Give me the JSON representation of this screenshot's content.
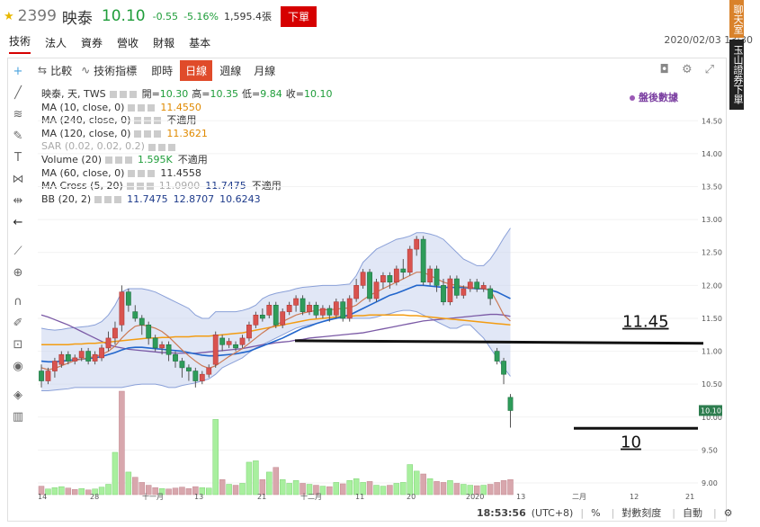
{
  "header": {
    "code": "2399",
    "name": "映泰",
    "price": "10.10",
    "change": "-0.55",
    "change_pct": "-5.16%",
    "volume": "1,595.4張",
    "order_button": "下單"
  },
  "side_buttons": {
    "chat": "聊天室",
    "order": "玉山證券下單"
  },
  "tabs": [
    "技術",
    "法人",
    "資券",
    "營收",
    "財報",
    "基本"
  ],
  "active_tab": "技術",
  "datetime": "2020/02/03 13:30",
  "toolbar": {
    "compare": "比較",
    "indicators": "技術指標",
    "realtime": "即時",
    "periods": [
      "日線",
      "週線",
      "月線"
    ],
    "active_period": "日線"
  },
  "legend": {
    "title": "映泰, 天, TWS",
    "ohlc": {
      "open_label": "開=",
      "open": "10.30",
      "high_label": "高=",
      "high": "10.35",
      "low_label": "低=",
      "low": "9.84",
      "close_label": "收=",
      "close": "10.10"
    },
    "rows": [
      {
        "label": "MA (10, close, 0)",
        "value": "11.4550",
        "extra": ""
      },
      {
        "label": "MA (240, close, 0)",
        "value": "",
        "extra": "不適用"
      },
      {
        "label": "MA (120, close, 0)",
        "value": "11.3621",
        "extra": ""
      },
      {
        "label": "SAR (0.02, 0.02, 0.2)",
        "value": "",
        "extra": ""
      },
      {
        "label": "Volume (20)",
        "value": "1.595K",
        "extra": "不適用"
      },
      {
        "label": "MA (60, close, 0)",
        "value": "11.4558",
        "extra": ""
      },
      {
        "label": "MA Cross (5, 20)",
        "value": "11.0900",
        "value2": "11.7475",
        "extra": "不適用"
      },
      {
        "label": "BB (20, 2)",
        "value": "11.7475",
        "value2": "12.8707",
        "value3": "10.6243"
      }
    ]
  },
  "after_data_label": "盤後數據",
  "annotations": {
    "line1": "11.45",
    "line2": "10"
  },
  "status": {
    "time": "18:53:56",
    "tz": "(UTC+8)",
    "pct": "%",
    "log": "對數刻度",
    "auto": "自動"
  },
  "colors": {
    "up": "#d9534f",
    "down": "#2e9c5a",
    "ma10": "#c0392b",
    "ma_orange": "#f39c12",
    "ma_blue": "#2266cc",
    "ma_purple": "#7b5aa6",
    "bb_fill": "#c9d3ef"
  },
  "chart_data": {
    "type": "candlestick",
    "y_ticks": [
      "14.50",
      "14.00",
      "13.50",
      "13.00",
      "12.50",
      "12.00",
      "11.50",
      "11.00",
      "10.50",
      "10.00",
      "9.50",
      "9.00"
    ],
    "ylim": [
      8.85,
      14.75
    ],
    "x_ticks": [
      "14",
      "28",
      "十一月",
      "13",
      "21",
      "十二月",
      "11",
      "20",
      "2020",
      "13",
      "二月",
      "12",
      "21"
    ],
    "last_price_label": "10.10",
    "candles": [
      [
        10.7,
        10.55,
        10.8,
        10.45
      ],
      [
        10.55,
        10.7,
        10.75,
        10.5
      ],
      [
        10.7,
        10.85,
        10.9,
        10.6
      ],
      [
        10.8,
        10.95,
        11.0,
        10.75
      ],
      [
        10.95,
        10.85,
        11.0,
        10.8
      ],
      [
        10.85,
        10.9,
        10.95,
        10.8
      ],
      [
        10.9,
        11.0,
        11.05,
        10.85
      ],
      [
        11.0,
        10.85,
        11.05,
        10.8
      ],
      [
        10.85,
        10.95,
        11.0,
        10.8
      ],
      [
        10.9,
        11.05,
        11.1,
        10.85
      ],
      [
        11.05,
        11.2,
        11.3,
        11.0
      ],
      [
        11.2,
        11.35,
        11.45,
        11.1
      ],
      [
        11.4,
        11.9,
        12.0,
        11.3
      ],
      [
        11.9,
        11.7,
        11.95,
        11.6
      ],
      [
        11.6,
        11.5,
        11.7,
        11.45
      ],
      [
        11.5,
        11.4,
        11.55,
        11.25
      ],
      [
        11.4,
        11.2,
        11.45,
        11.1
      ],
      [
        11.2,
        11.05,
        11.25,
        11.0
      ],
      [
        11.05,
        11.1,
        11.15,
        10.95
      ],
      [
        11.1,
        10.95,
        11.15,
        10.85
      ],
      [
        10.95,
        10.85,
        11.0,
        10.75
      ],
      [
        10.85,
        10.75,
        10.9,
        10.6
      ],
      [
        10.75,
        10.7,
        10.8,
        10.55
      ],
      [
        10.7,
        10.55,
        10.75,
        10.45
      ],
      [
        10.55,
        10.65,
        10.7,
        10.5
      ],
      [
        10.65,
        10.75,
        10.8,
        10.6
      ],
      [
        10.8,
        11.25,
        11.3,
        10.75
      ],
      [
        11.2,
        11.1,
        11.25,
        11.0
      ],
      [
        11.1,
        11.15,
        11.2,
        11.05
      ],
      [
        11.1,
        11.05,
        11.15,
        11.0
      ],
      [
        11.1,
        11.2,
        11.25,
        11.05
      ],
      [
        11.2,
        11.4,
        11.45,
        11.15
      ],
      [
        11.4,
        11.55,
        11.6,
        11.35
      ],
      [
        11.55,
        11.5,
        11.65,
        11.45
      ],
      [
        11.55,
        11.7,
        11.75,
        11.5
      ],
      [
        11.7,
        11.4,
        11.75,
        11.35
      ],
      [
        11.4,
        11.6,
        11.65,
        11.35
      ],
      [
        11.6,
        11.7,
        11.75,
        11.55
      ],
      [
        11.7,
        11.8,
        11.85,
        11.6
      ],
      [
        11.8,
        11.6,
        11.85,
        11.55
      ],
      [
        11.6,
        11.7,
        11.75,
        11.55
      ],
      [
        11.7,
        11.55,
        11.75,
        11.5
      ],
      [
        11.55,
        11.65,
        11.7,
        11.5
      ],
      [
        11.65,
        11.55,
        11.7,
        11.45
      ],
      [
        11.55,
        11.75,
        11.8,
        11.5
      ],
      [
        11.75,
        11.5,
        11.8,
        11.45
      ],
      [
        11.5,
        11.8,
        11.85,
        11.45
      ],
      [
        11.8,
        12.0,
        12.1,
        11.75
      ],
      [
        12.0,
        12.2,
        12.25,
        11.95
      ],
      [
        12.2,
        11.8,
        12.25,
        11.75
      ],
      [
        11.8,
        12.05,
        12.1,
        11.75
      ],
      [
        12.05,
        12.15,
        12.2,
        11.95
      ],
      [
        12.15,
        12.05,
        12.2,
        11.95
      ],
      [
        12.05,
        12.25,
        12.3,
        12.0
      ],
      [
        12.25,
        12.2,
        12.4,
        12.1
      ],
      [
        12.2,
        12.55,
        12.6,
        12.15
      ],
      [
        12.55,
        12.7,
        12.75,
        12.45
      ],
      [
        12.7,
        12.05,
        12.75,
        12.0
      ],
      [
        12.05,
        12.25,
        12.3,
        12.0
      ],
      [
        12.25,
        12.0,
        12.3,
        11.9
      ],
      [
        12.0,
        11.75,
        12.1,
        11.7
      ],
      [
        11.75,
        12.1,
        12.15,
        11.7
      ],
      [
        12.1,
        11.85,
        12.15,
        11.8
      ],
      [
        11.85,
        11.95,
        12.0,
        11.8
      ],
      [
        11.95,
        12.05,
        12.1,
        11.9
      ],
      [
        12.05,
        11.95,
        12.1,
        11.9
      ],
      [
        11.95,
        12.0,
        12.05,
        11.9
      ],
      [
        11.95,
        11.8,
        12.0,
        11.7
      ],
      [
        11.0,
        10.85,
        11.05,
        10.8
      ],
      [
        10.85,
        10.65,
        10.9,
        10.5
      ],
      [
        10.3,
        10.1,
        10.35,
        9.84
      ]
    ],
    "volumes": [
      [
        180,
        "down"
      ],
      [
        120,
        "up"
      ],
      [
        150,
        "up"
      ],
      [
        170,
        "up"
      ],
      [
        140,
        "down"
      ],
      [
        110,
        "down"
      ],
      [
        130,
        "up"
      ],
      [
        100,
        "down"
      ],
      [
        120,
        "up"
      ],
      [
        160,
        "up"
      ],
      [
        220,
        "up"
      ],
      [
        900,
        "up"
      ],
      [
        2200,
        "down"
      ],
      [
        480,
        "up"
      ],
      [
        370,
        "down"
      ],
      [
        260,
        "down"
      ],
      [
        200,
        "down"
      ],
      [
        150,
        "down"
      ],
      [
        130,
        "up"
      ],
      [
        120,
        "down"
      ],
      [
        140,
        "down"
      ],
      [
        160,
        "down"
      ],
      [
        130,
        "down"
      ],
      [
        170,
        "down"
      ],
      [
        150,
        "up"
      ],
      [
        140,
        "up"
      ],
      [
        1600,
        "up"
      ],
      [
        320,
        "down"
      ],
      [
        220,
        "up"
      ],
      [
        200,
        "down"
      ],
      [
        240,
        "up"
      ],
      [
        690,
        "up"
      ],
      [
        720,
        "up"
      ],
      [
        320,
        "down"
      ],
      [
        480,
        "up"
      ],
      [
        580,
        "down"
      ],
      [
        320,
        "up"
      ],
      [
        240,
        "up"
      ],
      [
        300,
        "up"
      ],
      [
        240,
        "down"
      ],
      [
        220,
        "up"
      ],
      [
        200,
        "down"
      ],
      [
        180,
        "up"
      ],
      [
        170,
        "down"
      ],
      [
        260,
        "up"
      ],
      [
        230,
        "down"
      ],
      [
        300,
        "up"
      ],
      [
        340,
        "up"
      ],
      [
        260,
        "up"
      ],
      [
        280,
        "down"
      ],
      [
        200,
        "up"
      ],
      [
        180,
        "up"
      ],
      [
        200,
        "down"
      ],
      [
        240,
        "up"
      ],
      [
        260,
        "up"
      ],
      [
        640,
        "up"
      ],
      [
        500,
        "up"
      ],
      [
        440,
        "down"
      ],
      [
        340,
        "up"
      ],
      [
        280,
        "down"
      ],
      [
        260,
        "down"
      ],
      [
        300,
        "up"
      ],
      [
        240,
        "down"
      ],
      [
        220,
        "up"
      ],
      [
        200,
        "up"
      ],
      [
        190,
        "down"
      ],
      [
        200,
        "up"
      ],
      [
        220,
        "down"
      ],
      [
        260,
        "down"
      ],
      [
        300,
        "down"
      ],
      [
        320,
        "down"
      ]
    ],
    "ma_blue": [
      10.85,
      10.84,
      10.84,
      10.85,
      10.86,
      10.87,
      10.88,
      10.89,
      10.9,
      10.92,
      10.95,
      10.98,
      11.02,
      11.05,
      11.06,
      11.06,
      11.05,
      11.04,
      11.03,
      11.02,
      11.01,
      11.0,
      10.98,
      10.96,
      10.94,
      10.93,
      10.93,
      10.94,
      10.95,
      10.96,
      10.98,
      11.0,
      11.04,
      11.08,
      11.12,
      11.16,
      11.2,
      11.25,
      11.3,
      11.35,
      11.38,
      11.42,
      11.45,
      11.48,
      11.5,
      11.53,
      11.55,
      11.6,
      11.65,
      11.7,
      11.75,
      11.8,
      11.85,
      11.88,
      11.92,
      11.96,
      12.0,
      12.0,
      11.99,
      11.98,
      11.97,
      11.97,
      11.97,
      11.97,
      11.96,
      11.95,
      11.95,
      11.93,
      11.9,
      11.85,
      11.8
    ],
    "ma_orange": [
      11.1,
      11.1,
      11.1,
      11.1,
      11.1,
      11.11,
      11.11,
      11.12,
      11.12,
      11.13,
      11.14,
      11.15,
      11.16,
      11.17,
      11.18,
      11.19,
      11.2,
      11.2,
      11.21,
      11.21,
      11.22,
      11.22,
      11.22,
      11.23,
      11.23,
      11.23,
      11.24,
      11.25,
      11.26,
      11.27,
      11.28,
      11.3,
      11.32,
      11.34,
      11.36,
      11.38,
      11.4,
      11.42,
      11.44,
      11.46,
      11.48,
      11.49,
      11.5,
      11.51,
      11.52,
      11.53,
      11.53,
      11.54,
      11.54,
      11.55,
      11.55,
      11.55,
      11.55,
      11.55,
      11.55,
      11.54,
      11.54,
      11.53,
      11.52,
      11.51,
      11.5,
      11.49,
      11.48,
      11.47,
      11.46,
      11.45,
      11.44,
      11.43,
      11.42,
      11.41,
      11.4
    ],
    "ma_purple": [
      11.55,
      11.52,
      11.48,
      11.44,
      11.4,
      11.35,
      11.3,
      11.25,
      11.2,
      11.15,
      11.1,
      11.07,
      11.05,
      11.03,
      11.02,
      11.01,
      11.0,
      10.99,
      10.98,
      10.98,
      10.97,
      10.97,
      10.97,
      10.97,
      10.98,
      10.99,
      11.0,
      11.01,
      11.02,
      11.03,
      11.04,
      11.06,
      11.08,
      11.1,
      11.11,
      11.13,
      11.14,
      11.15,
      11.17,
      11.18,
      11.2,
      11.21,
      11.22,
      11.23,
      11.24,
      11.25,
      11.26,
      11.27,
      11.28,
      11.3,
      11.32,
      11.34,
      11.36,
      11.38,
      11.4,
      11.42,
      11.44,
      11.46,
      11.47,
      11.48,
      11.49,
      11.5,
      11.51,
      11.52,
      11.53,
      11.54,
      11.55,
      11.56,
      11.56,
      11.55,
      11.53
    ],
    "bb_upper": [
      11.35,
      11.33,
      11.32,
      11.33,
      11.35,
      11.36,
      11.37,
      11.38,
      11.4,
      11.45,
      11.55,
      11.7,
      11.9,
      11.95,
      11.95,
      11.95,
      11.93,
      11.9,
      11.85,
      11.8,
      11.75,
      11.7,
      11.65,
      11.55,
      11.5,
      11.5,
      11.6,
      11.6,
      11.6,
      11.6,
      11.62,
      11.65,
      11.7,
      11.8,
      11.85,
      11.88,
      11.9,
      11.92,
      11.95,
      11.97,
      11.98,
      11.99,
      12.0,
      12.0,
      12.0,
      12.01,
      12.02,
      12.15,
      12.35,
      12.45,
      12.55,
      12.6,
      12.65,
      12.7,
      12.72,
      12.75,
      12.8,
      12.8,
      12.78,
      12.75,
      12.7,
      12.6,
      12.5,
      12.4,
      12.35,
      12.3,
      12.3,
      12.4,
      12.55,
      12.72,
      12.87
    ],
    "bb_lower": [
      10.4,
      10.4,
      10.41,
      10.42,
      10.43,
      10.45,
      10.45,
      10.45,
      10.45,
      10.45,
      10.45,
      10.45,
      10.45,
      10.47,
      10.49,
      10.5,
      10.5,
      10.5,
      10.48,
      10.45,
      10.45,
      10.48,
      10.5,
      10.52,
      10.55,
      10.58,
      10.65,
      10.75,
      10.8,
      10.85,
      10.9,
      10.98,
      11.05,
      11.1,
      11.15,
      11.2,
      11.25,
      11.3,
      11.35,
      11.38,
      11.4,
      11.42,
      11.45,
      11.47,
      11.5,
      11.5,
      11.5,
      11.5,
      11.5,
      11.5,
      11.52,
      11.55,
      11.57,
      11.6,
      11.62,
      11.62,
      11.6,
      11.55,
      11.5,
      11.45,
      11.4,
      11.35,
      11.35,
      11.4,
      11.4,
      11.3,
      11.2,
      11.05,
      10.9,
      10.75,
      10.62
    ],
    "ma_red": [
      10.75,
      10.72,
      10.74,
      10.78,
      10.82,
      10.86,
      10.88,
      10.9,
      10.92,
      10.95,
      11.0,
      11.08,
      11.2,
      11.3,
      11.38,
      11.4,
      11.38,
      11.35,
      11.3,
      11.22,
      11.12,
      11.02,
      10.93,
      10.85,
      10.78,
      10.74,
      10.78,
      10.85,
      10.92,
      10.98,
      11.04,
      11.12,
      11.2,
      11.28,
      11.35,
      11.4,
      11.45,
      11.5,
      11.55,
      11.58,
      11.6,
      11.62,
      11.63,
      11.63,
      11.64,
      11.65,
      11.66,
      11.7,
      11.78,
      11.85,
      11.9,
      11.95,
      12.0,
      12.05,
      12.1,
      12.15,
      12.2,
      12.2,
      12.15,
      12.1,
      12.05,
      12.02,
      12.0,
      11.98,
      11.97,
      11.96,
      11.95,
      11.93,
      11.75,
      11.55,
      11.46
    ]
  }
}
